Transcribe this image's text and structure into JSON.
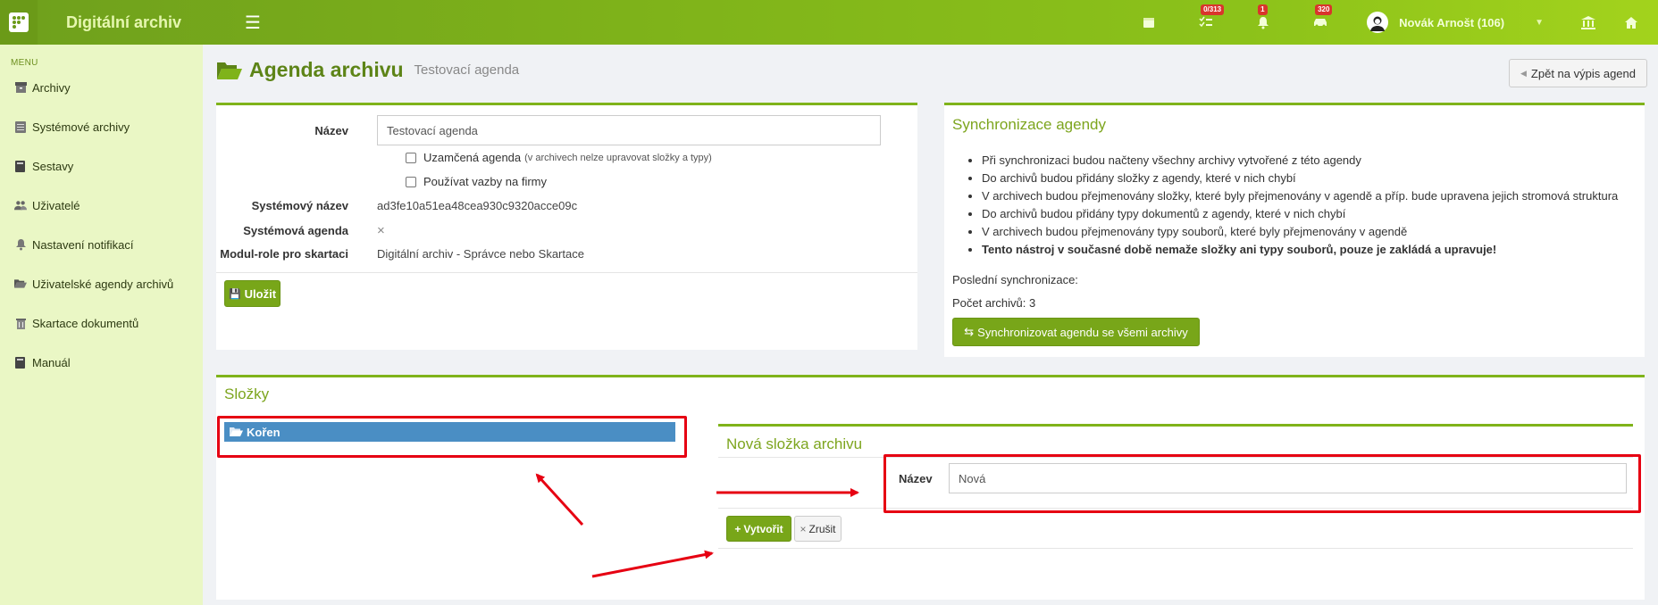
{
  "app": {
    "title": "Digitální archiv"
  },
  "topbar": {
    "calendar_icon": "calendar-icon",
    "tasks_badge": "0/313",
    "notifications_badge": "1",
    "cars_badge": "320",
    "user_name": "Novák Arnošt (106)"
  },
  "sidebar": {
    "menu_label": "MENU",
    "items": [
      {
        "label": "Archivy",
        "icon": "archive-icon"
      },
      {
        "label": "Systémové archivy",
        "icon": "database-icon"
      },
      {
        "label": "Sestavy",
        "icon": "book-icon"
      },
      {
        "label": "Uživatelé",
        "icon": "users-icon"
      },
      {
        "label": "Nastavení notifikací",
        "icon": "bell-icon"
      },
      {
        "label": "Uživatelské agendy archivů",
        "icon": "folder-open-icon"
      },
      {
        "label": "Skartace dokumentů",
        "icon": "trash-icon"
      },
      {
        "label": "Manuál",
        "icon": "book-icon"
      }
    ]
  },
  "header": {
    "title": "Agenda archivu",
    "subtitle": "Testovací agenda",
    "back_label": "Zpět na výpis agend"
  },
  "form": {
    "name_label": "Název",
    "name_value": "Testovací agenda",
    "locked_label": "Uzamčená agenda",
    "locked_note": "(v archivech nelze upravovat složky a typy)",
    "use_links_label": "Používat vazby na firmy",
    "system_name_label": "Systémový název",
    "system_name_value": "ad3fe10a51ea48cea930c9320acce09c",
    "system_agenda_label": "Systémová agenda",
    "system_agenda_value": "×",
    "module_role_label": "Modul-role pro skartaci",
    "module_role_value": "Digitální archiv - Správce nebo Skartace",
    "save_label": "Uložit"
  },
  "sync": {
    "title": "Synchronizace agendy",
    "items": [
      "Při synchronizaci budou načteny všechny archivy vytvořené z této agendy",
      "Do archivů budou přidány složky z agendy, které v nich chybí",
      "V archivech budou přejmenovány složky, které byly přejmenovány v agendě a příp. bude upravena jejich stromová struktura",
      "Do archivů budou přidány typy dokumentů z agendy, které v nich chybí",
      "V archivech budou přejmenovány typy souborů, které byly přejmenovány v agendě"
    ],
    "warning": "Tento nástroj v současné době nemaže složky ani typy souborů, pouze je zakládá a upravuje!",
    "last_sync_label": "Poslední synchronizace:",
    "archive_count_label": "Počet archivů: 3",
    "sync_button_label": "Synchronizovat agendu se všemi archivy"
  },
  "folders": {
    "title": "Složky",
    "root_label": "Kořen",
    "new_folder": {
      "title": "Nová složka archivu",
      "name_label": "Název",
      "name_value": "Nová",
      "create_label": "Vytvořit",
      "cancel_label": "Zrušit"
    }
  },
  "colors": {
    "accent": "#7fb31a",
    "sidebar_bg": "#eaf7c5",
    "tree_selected": "#4a8ec4",
    "annotation_red": "#e60012"
  }
}
